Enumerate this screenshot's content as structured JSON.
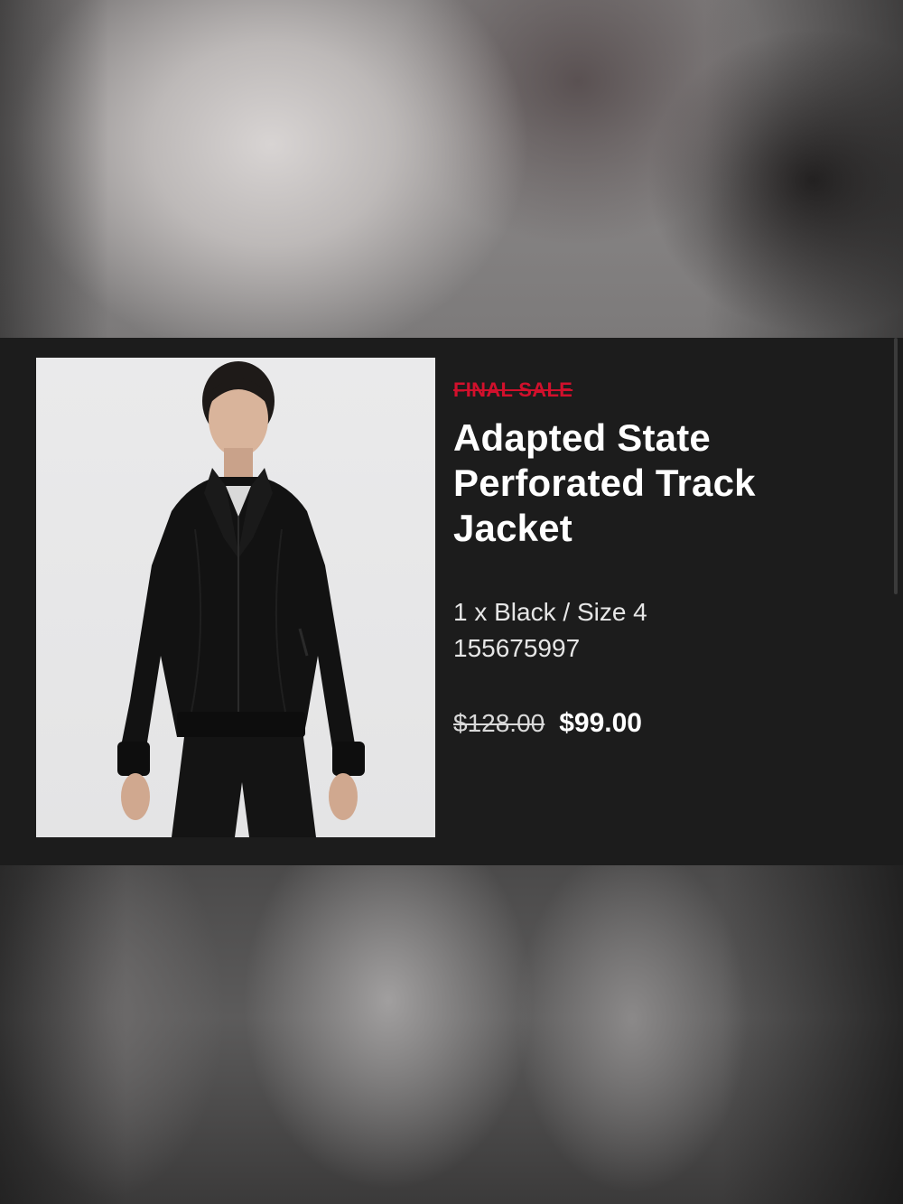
{
  "product": {
    "badge": "FINAL SALE",
    "title": "Adapted State Perforated Track Jacket",
    "variant": "1 x Black / Size 4",
    "sku": "155675997",
    "price_original": "$128.00",
    "price_sale": "$99.00",
    "badge_color": "#d1102c",
    "image_alt": "woman wearing black track jacket"
  }
}
